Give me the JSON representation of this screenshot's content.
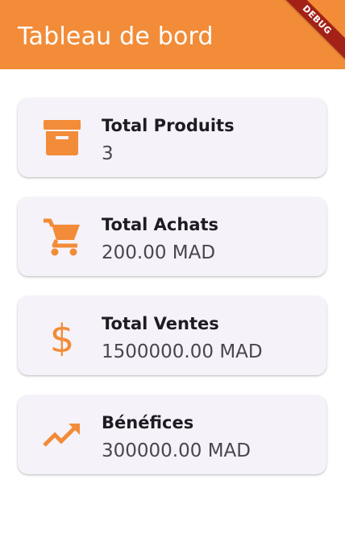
{
  "app_bar": {
    "title": "Tableau de bord",
    "debug_badge": "DEBUG",
    "color": "#F28C38"
  },
  "accent_color": "#F28C38",
  "cards": [
    {
      "icon": "archive-box-icon",
      "label": "Total Produits",
      "value": "3"
    },
    {
      "icon": "shopping-cart-icon",
      "label": "Total Achats",
      "value": "200.00 MAD"
    },
    {
      "icon": "dollar-icon",
      "label": "Total Ventes",
      "value": "1500000.00 MAD"
    },
    {
      "icon": "trending-up-icon",
      "label": "Bénéfices",
      "value": "300000.00 MAD"
    }
  ]
}
